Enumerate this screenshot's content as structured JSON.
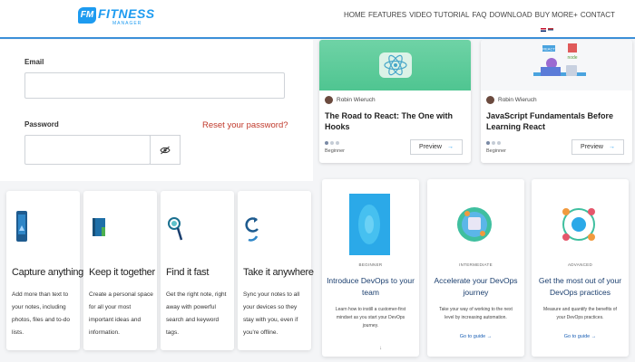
{
  "header": {
    "logo": {
      "mark": "FM",
      "brand": "FITNESS",
      "sub": "MANAGER"
    },
    "nav": [
      "HOME",
      "FEATURES",
      "VIDEO TUTORIAL",
      "FAQ",
      "DOWNLOAD",
      "BUY MORE+",
      "CONTACT"
    ]
  },
  "form": {
    "email_label": "Email",
    "email_value": "",
    "password_label": "Password",
    "password_value": "",
    "reset_link": "Reset your password?"
  },
  "courses": [
    {
      "author": "Robin Wieruch",
      "title": "The Road to React: The One with Hooks",
      "level": "Beginner",
      "preview": "Preview"
    },
    {
      "author": "Robin Wieruch",
      "title": "JavaScript Fundamentals Before Learning React",
      "level": "Beginner",
      "preview": "Preview",
      "img_badges": [
        "REACT",
        "node"
      ]
    }
  ],
  "features": [
    {
      "icon": "phone-icon",
      "title": "Capture anything",
      "text": "Add more than text to your notes, including photos, files and to-do lists."
    },
    {
      "icon": "notebook-icon",
      "title": "Keep it together",
      "text": "Create a personal space for all your most important ideas and information."
    },
    {
      "icon": "magnifier-icon",
      "title": "Find it fast",
      "text": "Get the right note, right away with powerful search and keyword tags."
    },
    {
      "icon": "sync-icon",
      "title": "Take it anywhere",
      "text": "Sync your notes to all your devices so they stay with you, even if you're offline."
    }
  ],
  "devops": [
    {
      "tag": "BEGINNER",
      "title": "Introduce DevOps to your team",
      "text": "Learn how to instill a customer-first mindset as you start your DevOps journey.",
      "link": ""
    },
    {
      "tag": "INTERMEDIATE",
      "title": "Accelerate your DevOps journey",
      "text": "Take your way of working to the next level by increasing automation.",
      "link": "Go to guide →"
    },
    {
      "tag": "ADVANCED",
      "title": "Get the most out of your DevOps practices",
      "text": "Measure and quantify the benefits of your DevOps practices.",
      "link": "Go to guide →"
    }
  ],
  "scroll_mark": "↓"
}
